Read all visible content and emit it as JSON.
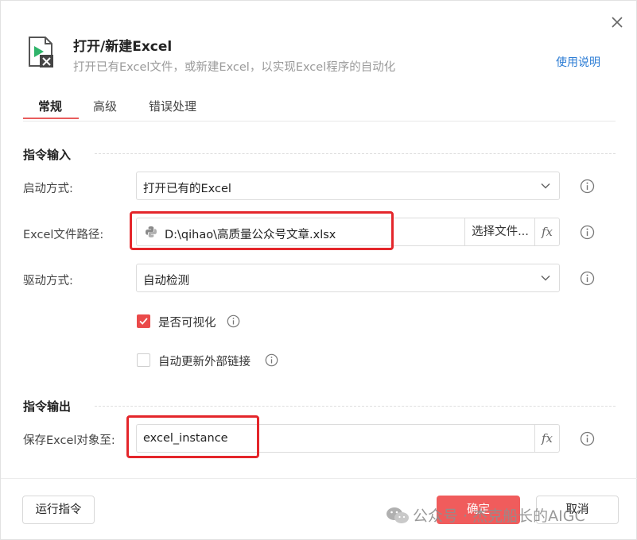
{
  "dialog": {
    "title": "打开/新建Excel",
    "subtitle": "打开已有Excel文件，或新建Excel，以实现Excel程序的自动化",
    "help_link": "使用说明",
    "close_icon": "close-icon"
  },
  "tabs": [
    {
      "label": "常规",
      "active": true
    },
    {
      "label": "高级",
      "active": false
    },
    {
      "label": "错误处理",
      "active": false
    }
  ],
  "input_section": {
    "title": "指令输入",
    "launch_mode": {
      "label": "启动方式:",
      "value": "打开已有的Excel"
    },
    "file_path": {
      "label": "Excel文件路径:",
      "value": "D:\\qihao\\高质量公众号文章.xlsx",
      "select_button": "选择文件...",
      "fx": "fx"
    },
    "driver_mode": {
      "label": "驱动方式:",
      "value": "自动检测"
    },
    "visible": {
      "label": "是否可视化",
      "checked": true
    },
    "update_links": {
      "label": "自动更新外部链接",
      "checked": false
    }
  },
  "output_section": {
    "title": "指令输出",
    "save_to": {
      "label": "保存Excel对象至:",
      "value": "excel_instance",
      "fx": "fx"
    }
  },
  "footer": {
    "run_button": "运行指令",
    "confirm_button": "确定",
    "cancel_button": "取消"
  },
  "watermark": "公众号 · 杰克船长的AIGC",
  "colors": {
    "accent": "#f05c5c",
    "link": "#2a7bd4",
    "highlight_box": "#e4262b"
  }
}
